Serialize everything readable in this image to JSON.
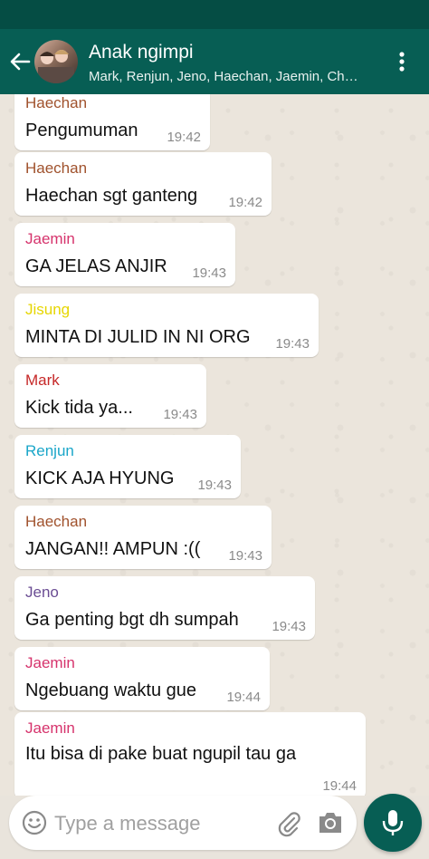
{
  "header": {
    "title": "Anak ngimpi",
    "subtitle": "Mark, Renjun, Jeno, Haechan, Jaemin, Chenle, Jisung"
  },
  "messages": [
    {
      "sender": "Haechan",
      "text": "Pengumuman",
      "time": "19:42",
      "color": "#a0522d"
    },
    {
      "sender": "Haechan",
      "text": "Haechan sgt ganteng",
      "time": "19:42",
      "color": "#a0522d"
    },
    {
      "sender": "Jaemin",
      "text": "GA JELAS ANJIR",
      "time": "19:43",
      "color": "#d6336c"
    },
    {
      "sender": "Jisung",
      "text": "MINTA DI JULID IN NI ORG",
      "time": "19:43",
      "color": "#e6d600"
    },
    {
      "sender": "Mark",
      "text": "Kick tida ya...",
      "time": "19:43",
      "color": "#c62828"
    },
    {
      "sender": "Renjun",
      "text": "KICK AJA HYUNG",
      "time": "19:43",
      "color": "#1aa6c9"
    },
    {
      "sender": "Haechan",
      "text": "JANGAN!! AMPUN :((",
      "time": "19:43",
      "color": "#a0522d"
    },
    {
      "sender": "Jeno",
      "text": "Ga penting bgt dh sumpah",
      "time": "19:43",
      "color": "#6a4c93"
    },
    {
      "sender": "Jaemin",
      "text": "Ngebuang waktu gue",
      "time": "19:44",
      "color": "#d6336c"
    },
    {
      "sender": "Jaemin",
      "text": "Itu bisa di pake buat ngupil tau ga",
      "time": "19:44",
      "color": "#d6336c"
    }
  ],
  "input": {
    "placeholder": "Type a message"
  },
  "icons": {
    "back": "arrow-left-icon",
    "menu": "more-vertical-icon",
    "emoji": "emoji-icon",
    "attach": "paperclip-icon",
    "camera": "camera-icon",
    "mic": "microphone-icon"
  },
  "colors": {
    "header": "#075e54",
    "statusbar": "#054d44",
    "mic_button": "#075e54"
  }
}
